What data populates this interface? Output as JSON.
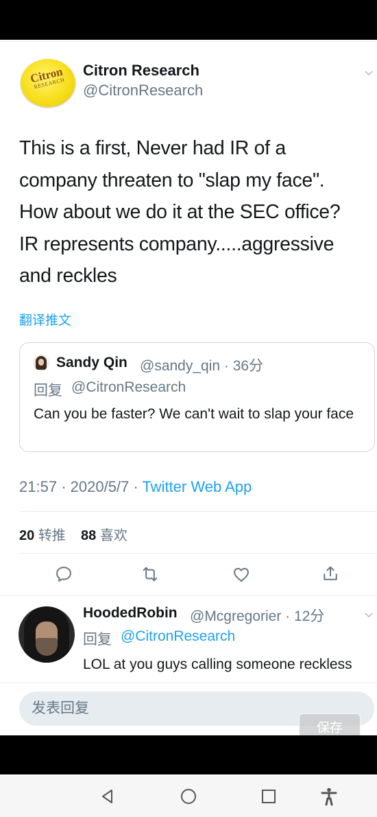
{
  "tweet": {
    "author_name": "Citron Research",
    "author_handle": "@CitronResearch",
    "avatar_text_main": "Citron",
    "avatar_text_sub": "RESEARCH",
    "text": "This is a first, Never had IR of a\ncompany threaten to \"slap my face\".\nHow about we do it at the SEC office?\nIR represents company.....aggressive\nand reckles",
    "translate_label": "翻译推文",
    "time": "21:57",
    "date": "2020/5/7",
    "source": "Twitter Web App",
    "retweets": "20",
    "retweets_label": "转推",
    "likes": "88",
    "likes_label": "喜欢"
  },
  "quoted": {
    "author_name": "Sandy Qin",
    "handle_time": "@sandy_qin · 36分",
    "reply_prefix": "回复",
    "reply_to": "@CitronResearch",
    "text": "Can you be faster? We can't wait to slap your face"
  },
  "reply": {
    "author_name": "HoodedRobin",
    "handle_time": "@Mcgregorier · 12分",
    "reply_prefix": "回复",
    "reply_to": "@CitronResearch",
    "text": "LOL at you guys calling someone reckless"
  },
  "composer": {
    "placeholder": "发表回复",
    "save_label": "保存"
  },
  "icons": {
    "actions": [
      "reply-icon",
      "retweet-icon",
      "like-icon",
      "share-icon"
    ],
    "nav": [
      "back-icon",
      "home-icon",
      "recent-apps-icon",
      "accessibility-icon"
    ]
  },
  "colors": {
    "link": "#1da1f2",
    "secondary_text": "#657786",
    "primary_text": "#14171a"
  }
}
